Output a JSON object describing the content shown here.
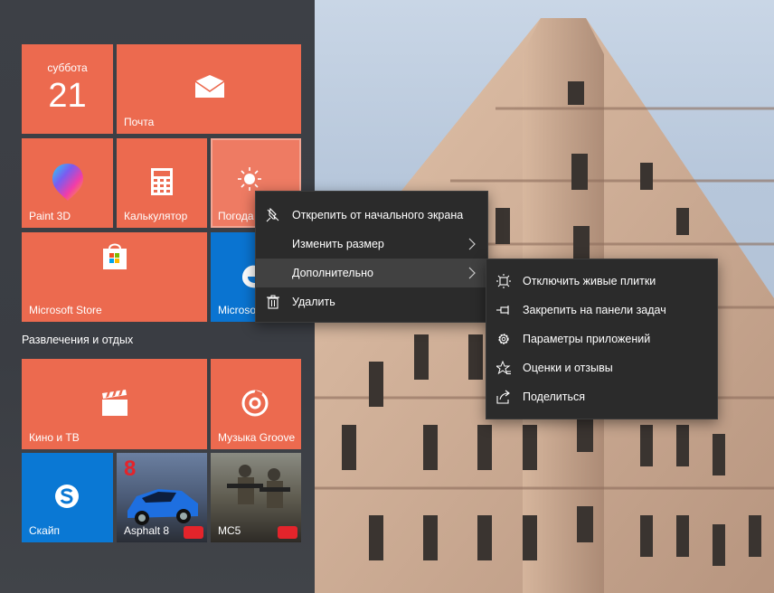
{
  "tiles": {
    "calendar": {
      "day_name": "суббота",
      "day_number": "21"
    },
    "mail": {
      "label": "Почта",
      "icon": "mail-icon"
    },
    "paint3d": {
      "label": "Paint 3D",
      "icon": "paint3d-icon"
    },
    "calculator": {
      "label": "Калькулятор",
      "icon": "calculator-icon"
    },
    "weather": {
      "label": "Погода",
      "icon": "sun-icon"
    },
    "store": {
      "label": "Microsoft Store",
      "icon": "store-bag-icon"
    },
    "edge": {
      "label": "Microsoft Edge",
      "icon": "edge-icon"
    },
    "movies": {
      "label": "Кино и ТВ",
      "icon": "clapperboard-icon"
    },
    "music": {
      "label": "Музыка Groove",
      "icon": "groove-disc-icon"
    },
    "skype": {
      "label": "Скайп",
      "icon": "skype-icon"
    },
    "asphalt": {
      "label": "Asphalt 8",
      "badge": "8"
    },
    "mc5": {
      "label": "MC5"
    }
  },
  "group_title": "Развлечения и отдых",
  "context_menu": {
    "items": [
      {
        "label": "Открепить от начального экрана",
        "icon": "unpin-icon"
      },
      {
        "label": "Изменить размер",
        "icon": "",
        "submenu": true
      },
      {
        "label": "Дополнительно",
        "icon": "",
        "submenu": true
      },
      {
        "label": "Удалить",
        "icon": "trash-icon"
      }
    ]
  },
  "submenu": {
    "items": [
      {
        "label": "Отключить живые плитки",
        "icon": "live-tile-off-icon"
      },
      {
        "label": "Закрепить на панели задач",
        "icon": "pin-taskbar-icon"
      },
      {
        "label": "Параметры приложений",
        "icon": "gear-icon"
      },
      {
        "label": "Оценки и отзывы",
        "icon": "star-review-icon"
      },
      {
        "label": "Поделиться",
        "icon": "share-icon"
      }
    ]
  },
  "colors": {
    "tile_orange": "#ec6a4f",
    "tile_blue": "#0a74d1",
    "menu_bg": "#2b2b2b",
    "menu_hover": "#414141",
    "start_bg": "#3d4046"
  }
}
